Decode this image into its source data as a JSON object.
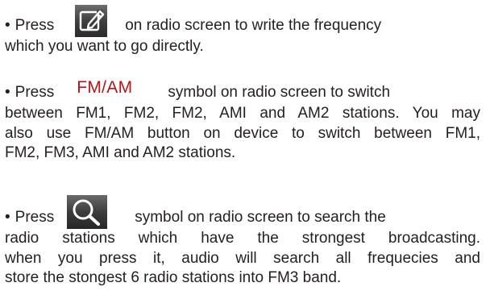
{
  "bullet": "•",
  "paragraphs": {
    "edit": {
      "lead": "Press",
      "icon": "edit-icon",
      "line1_rest": "on radio screen to write the frequency",
      "line2": "which you want to go directly."
    },
    "band": {
      "lead": "Press",
      "symbol_label": "FM/AM",
      "line1_rest": "symbol on radio screen to switch",
      "line2": "between FM1, FM2, FM2, AMI and AM2 stations. You may",
      "line3": "also use FM/AM button on device to switch between FM1,",
      "line4": "FM2, FM3, AMI and AM2 stations."
    },
    "search": {
      "lead": "Press",
      "icon": "search-icon",
      "line1_rest": "symbol on radio screen to search the",
      "line2": "radio stations which have the strongest broadcasting.",
      "line3": "when you press it, audio will search all frequecies and",
      "line4": "store the stongest 6 radio stations into FM3 band."
    }
  },
  "colors": {
    "text": "#231f20",
    "fmam_red": "#b3151b",
    "icon_bg_dark": "#3a3a3a",
    "icon_bg_light": "#6d6d6d"
  }
}
